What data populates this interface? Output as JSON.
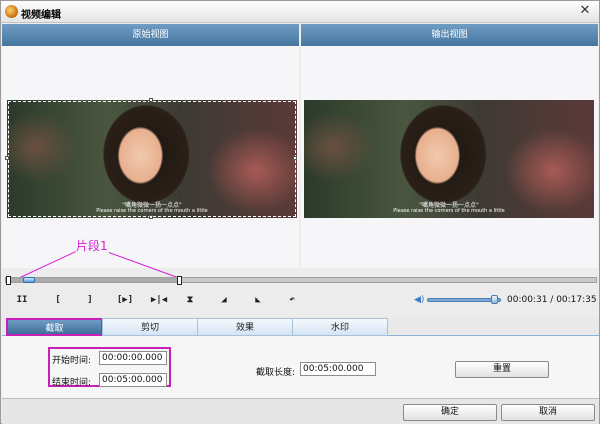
{
  "window": {
    "title": "视频编辑"
  },
  "views": {
    "original_label": "原始视图",
    "output_label": "输出视图"
  },
  "video": {
    "subtitle_cn": "\"嘴角微微一扬一点点\"",
    "subtitle_en": "Please raise the corners of the mouth a little"
  },
  "annotation": {
    "segment_label": "片段1",
    "color": "#d81fd8"
  },
  "player": {
    "controls": [
      {
        "name": "pause-icon",
        "glyph": "II"
      },
      {
        "name": "mark-in-icon",
        "glyph": "["
      },
      {
        "name": "mark-out-icon",
        "glyph": "]"
      },
      {
        "name": "play-selection-icon",
        "glyph": "[▶]"
      },
      {
        "name": "frame-step-icon",
        "glyph": "▶|◀"
      },
      {
        "name": "cut-marker-icon",
        "glyph": "⧗"
      },
      {
        "name": "ramp-in-icon",
        "glyph": "◢"
      },
      {
        "name": "ramp-out-icon",
        "glyph": "◣"
      },
      {
        "name": "undo-icon",
        "glyph": "↶"
      }
    ],
    "current_time": "00:00:31",
    "total_time": "00:17:35",
    "time_separator": " / ",
    "volume_icon": "speaker-icon",
    "volume_level": 0.92,
    "accent_color": "#3c7dc8"
  },
  "tabs": [
    {
      "label": "截取",
      "active": true
    },
    {
      "label": "剪切",
      "active": false
    },
    {
      "label": "效果",
      "active": false
    },
    {
      "label": "水印",
      "active": false
    }
  ],
  "clip": {
    "start_label": "开始时间:",
    "start_value": "00:00:00.000",
    "end_label": "结束时间:",
    "end_value": "00:05:00.000",
    "length_label": "截取长度:",
    "length_value": "00:05:00.000",
    "reset_label": "重置"
  },
  "footer": {
    "ok_label": "确定",
    "cancel_label": "取消"
  }
}
